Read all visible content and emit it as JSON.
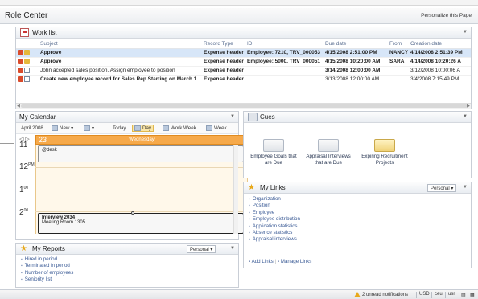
{
  "page": {
    "title": "Role Center",
    "personalize_label": "Personalize this Page"
  },
  "worklist": {
    "title": "Work list",
    "columns": [
      "Subject",
      "Record Type",
      "ID",
      "Due date",
      "From",
      "Creation date"
    ],
    "rows": [
      {
        "subject": "Approve",
        "record_type": "Expense header",
        "id": "Employee: 7210, TRV_000053",
        "due": "4/15/2008 2:51:00 PM",
        "from": "NANCY",
        "created": "4/14/2008 2:51:39 PM",
        "bold": true,
        "selected": true
      },
      {
        "subject": "Approve",
        "record_type": "Expense header",
        "id": "Employee: 5000, TRV_000051",
        "due": "4/15/2008 10:20:00 AM",
        "from": "SARA",
        "created": "4/14/2008 10:20:26 A",
        "bold": true,
        "selected": false
      },
      {
        "subject": "John accepted sales position. Assign employee to position",
        "record_type": "Expense header",
        "id": "",
        "due": "3/14/2008 12:00:00 AM",
        "from": "",
        "created": "3/12/2008 10:00:06 A",
        "bold": false,
        "selected": false
      },
      {
        "subject": "Create new employee record for Sales Rep Starting on March 1",
        "record_type": "Expense header",
        "id": "",
        "due": "3/13/2008 12:00:00 AM",
        "from": "",
        "created": "3/4/2008 7:15:49 PM",
        "bold": false,
        "selected": false
      }
    ]
  },
  "calendar": {
    "title": "My Calendar",
    "month": "April 2008",
    "toolbar": {
      "new": "New",
      "today": "Today",
      "day": "Day",
      "work_week": "Work Week",
      "week": "Week"
    },
    "day_number": "23",
    "day_name": "Wednesday",
    "hours": [
      "11",
      "12",
      "1",
      "2"
    ],
    "hour_suffix": {
      "12": "PM",
      "1": "00",
      "2": "00"
    },
    "appointments": [
      {
        "title": "@desk",
        "location": ""
      },
      {
        "title": "Interview 2034",
        "location": "Meeting Room 1305"
      }
    ]
  },
  "cues": {
    "title": "Cues",
    "tiles": [
      {
        "label": "Employee Goals that are Due"
      },
      {
        "label": "Appraisal Interviews that are Due"
      },
      {
        "label": "Expiring Recruitment Projects"
      }
    ]
  },
  "my_links": {
    "title": "My Links",
    "dropdown": "Personal",
    "items": [
      "Organization",
      "Position",
      "Employee",
      "Employee distribution",
      "Application statistics",
      "Absence statistics",
      "Appraisal interviews"
    ],
    "footer": {
      "add": "Add Links",
      "manage": "Manage Links"
    }
  },
  "my_reports": {
    "title": "My Reports",
    "dropdown": "Personal",
    "items": [
      "Hired in period",
      "Terminated in period",
      "Number of employees",
      "Seniority list"
    ]
  },
  "statusbar": {
    "notifications": "2 unread notifications",
    "currency": "USD",
    "company": "ceu",
    "user": "usr"
  }
}
